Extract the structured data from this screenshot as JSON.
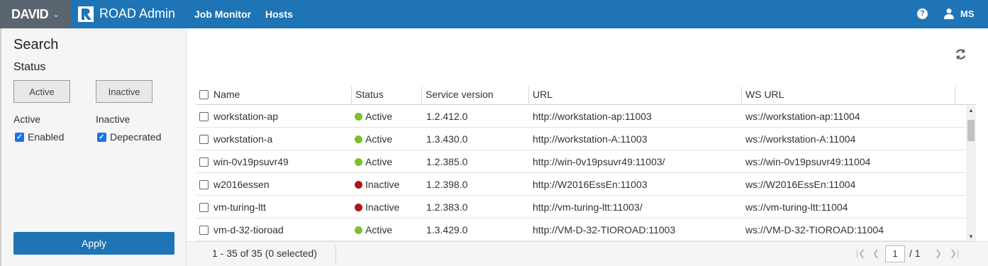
{
  "topbar": {
    "brand": "DAVID",
    "app_title": "ROAD Admin",
    "nav": [
      "Job Monitor",
      "Hosts"
    ],
    "user_initials": "MS"
  },
  "sidebar": {
    "search_title": "Search",
    "status_title": "Status",
    "active_button": "Active",
    "inactive_button": "Inactive",
    "active_group": "Active",
    "inactive_group": "Inactive",
    "enabled_label": "Enabled",
    "deprecated_label": "Depecrated",
    "apply_label": "Apply"
  },
  "grid": {
    "columns": [
      "Name",
      "Status",
      "Service version",
      "URL",
      "WS URL"
    ],
    "rows": [
      {
        "name": "workstation-ap",
        "status": "Active",
        "version": "1.2.412.0",
        "url": "http://workstation-ap:11003",
        "ws_url": "ws://workstation-ap:11004"
      },
      {
        "name": "workstation-a",
        "status": "Active",
        "version": "1.3.430.0",
        "url": "http://workstation-A:11003",
        "ws_url": "ws://workstation-A:11004"
      },
      {
        "name": "win-0v19psuvr49",
        "status": "Active",
        "version": "1.2.385.0",
        "url": "http://win-0v19psuvr49:11003/",
        "ws_url": "ws://win-0v19psuvr49:11004"
      },
      {
        "name": "w2016essen",
        "status": "Inactive",
        "version": "1.2.398.0",
        "url": "http://W2016EssEn:11003",
        "ws_url": "ws://W2016EssEn:11004"
      },
      {
        "name": "vm-turing-ltt",
        "status": "Inactive",
        "version": "1.2.383.0",
        "url": "http://vm-turing-ltt:11003/",
        "ws_url": "ws://vm-turing-ltt:11004"
      },
      {
        "name": "vm-d-32-tioroad",
        "status": "Active",
        "version": "1.3.429.0",
        "url": "http://VM-D-32-TIOROAD:11003",
        "ws_url": "ws://VM-D-32-TIOROAD:11004"
      }
    ]
  },
  "footer": {
    "count_text": "1 - 35 of 35 (0 selected)",
    "page": "1",
    "page_total": "/ 1"
  },
  "colors": {
    "active": "#7cbf2a",
    "inactive": "#b01818",
    "brand_blue": "#1f74b5"
  }
}
